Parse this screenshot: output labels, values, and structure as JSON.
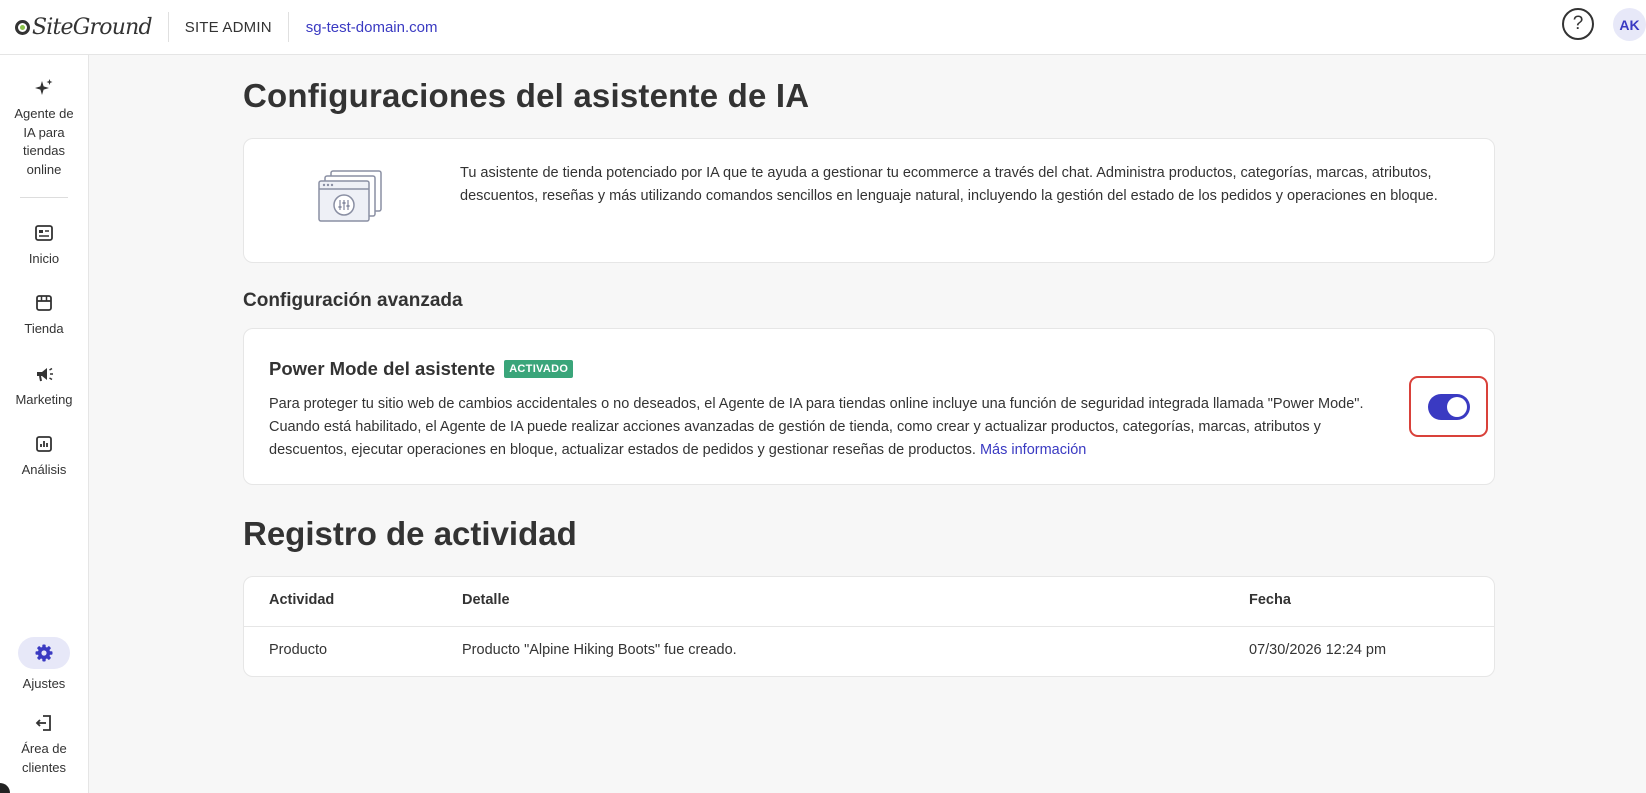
{
  "header": {
    "brand": "SiteGround",
    "section": "SITE ADMIN",
    "domain": "sg-test-domain.com",
    "help_icon": "question-circle-icon",
    "help_glyph": "?",
    "user_initials": "AK"
  },
  "sidebar": {
    "items": [
      {
        "label": "Agente de IA para tiendas online",
        "icon": "sparkles-icon"
      },
      {
        "label": "Inicio",
        "icon": "home-dashboard-icon"
      },
      {
        "label": "Tienda",
        "icon": "store-icon"
      },
      {
        "label": "Marketing",
        "icon": "megaphone-icon"
      },
      {
        "label": "Análisis",
        "icon": "bar-chart-icon"
      },
      {
        "label": "Ajustes",
        "icon": "gear-icon",
        "active": true
      },
      {
        "label": "Área de clientes",
        "icon": "exit-icon"
      }
    ]
  },
  "main": {
    "title": "Configuraciones del asistente de IA",
    "intro": "Tu asistente de tienda potenciado por IA que te ayuda a gestionar tu ecommerce a través del chat. Administra productos, categorías, marcas, atributos, descuentos, reseñas y más utilizando comandos sencillos en lenguaje natural, incluyendo la gestión del estado de los pedidos y operaciones en bloque.",
    "advanced_title": "Configuración avanzada",
    "power_mode": {
      "title": "Power Mode del asistente",
      "badge": "ACTIVADO",
      "description": "Para proteger tu sitio web de cambios accidentales o no deseados, el Agente de IA para tiendas online incluye una función de seguridad integrada llamada \"Power Mode\". Cuando está habilitado, el Agente de IA puede realizar acciones avanzadas de gestión de tienda, como crear y actualizar productos, categorías, marcas, atributos y descuentos, ejecutar operaciones en bloque, actualizar estados de pedidos y gestionar reseñas de productos. ",
      "link": "Más información",
      "enabled": true
    },
    "activity": {
      "title": "Registro de actividad",
      "columns": [
        "Actividad",
        "Detalle",
        "Fecha"
      ],
      "rows": [
        [
          "Producto",
          "Producto \"Alpine Hiking Boots\" fue creado.",
          "07/30/2026 12:24 pm"
        ]
      ]
    }
  },
  "colors": {
    "accent": "#3a3ac2",
    "badge": "#3aa57a",
    "highlight": "#d9413a"
  }
}
